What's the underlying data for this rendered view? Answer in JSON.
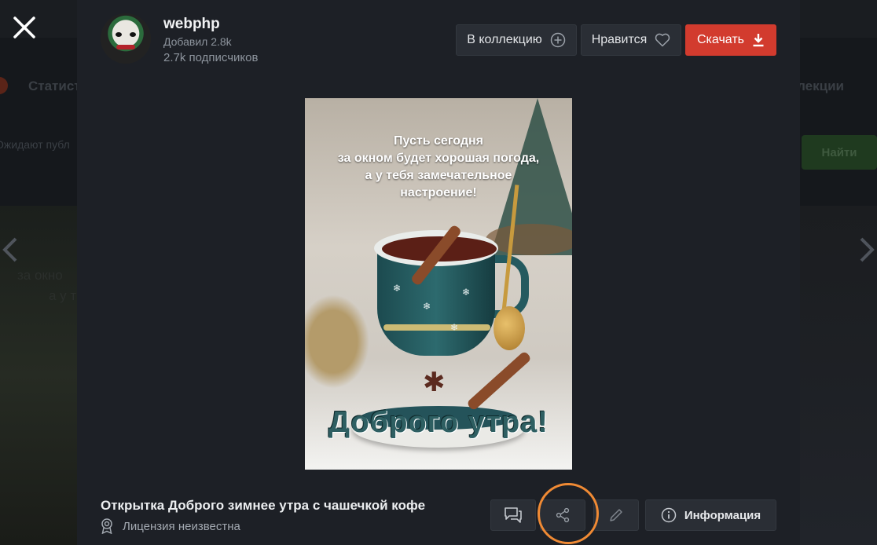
{
  "background": {
    "nav_left": "Статистик",
    "nav_right": "лекции",
    "search_hint": "Ожидают публ",
    "find_button": "Найти",
    "left_text_line1": "за окно",
    "left_text_line2": "а у т"
  },
  "author": {
    "name": "webphp",
    "added": "Добавил 2.8k",
    "subscribers": "2.7k подписчиков"
  },
  "actions": {
    "collection_label": "В коллекцию",
    "like_label": "Нравится",
    "download_label": "Скачать"
  },
  "image_text": {
    "top_line1": "Пусть сегодня",
    "top_line2": "за окном будет хорошая погода,",
    "top_line3": "а у тебя замечательное",
    "top_line4": "настроение!",
    "bottom": "Доброго утра!"
  },
  "details": {
    "title": "Открытка Доброго зимнее утра с чашечкой кофе",
    "license": "Лицензия неизвестна",
    "info_label": "Информация"
  },
  "colors": {
    "accent_download": "#d23b2e",
    "highlight": "#f08a34"
  },
  "icons": [
    "close-icon",
    "plus-circle-icon",
    "heart-icon",
    "download-icon",
    "comment-icon",
    "share-icon",
    "pencil-icon",
    "info-icon",
    "license-icon",
    "chevron-left-icon",
    "chevron-right-icon"
  ]
}
